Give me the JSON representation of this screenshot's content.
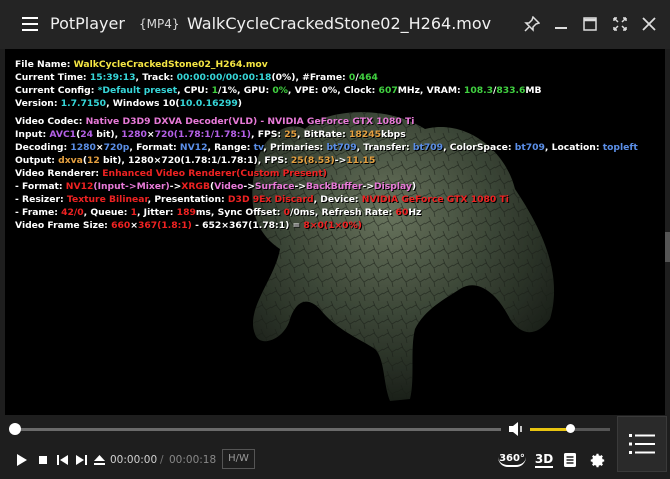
{
  "titlebar": {
    "app_name": "PotPlayer",
    "format_tag": "{MP4}",
    "file_title": "WalkCycleCrackedStone02_H264.mov"
  },
  "osd": {
    "file_name": {
      "label": "File Name: ",
      "value": "WalkCycleCrackedStone02_H264.mov"
    },
    "current_time": {
      "label": "Current Time: ",
      "time": "15:39:13",
      "track_label": ", Track: ",
      "track_pos": "00:00:00",
      "track_dur": "00:00:18",
      "pct": "(0%)",
      "frame_label": ", #Frame: ",
      "frame_cur": "0",
      "frame_total": "464"
    },
    "current_config": {
      "label": "Current Config: ",
      "preset": "*Default preset",
      "cpu_label": ", CPU: ",
      "cpu_val": "1",
      "cpu_pct": "1%",
      "gpu_label": ", GPU: ",
      "gpu_val": "0%",
      "vpe_label": ", VPE: ",
      "vpe_val": "0%",
      "clock_label": ", Clock: ",
      "clock_val": "607",
      "clock_unit": "MHz, VRAM: ",
      "vram_used": "108.3",
      "vram_total": "833.6",
      "vram_unit": "MB"
    },
    "version": {
      "label": "Version: ",
      "value": "1.7.7150",
      "os_label": ", Windows 10(",
      "os_build": "10.0.16299",
      "close": ")"
    },
    "video_codec": {
      "label": "Video Codec: ",
      "value": "Native D3D9 DXVA Decoder(VLD) - NVIDIA GeForce GTX 1080 Ti"
    },
    "input": {
      "label": "Input: ",
      "codec": "AVC1",
      "bits": "24",
      "bits_unit": " bit), ",
      "width": "1280",
      "height": "720",
      "aspect": "(1.78:1/1.78:1)",
      "fps_label": ", FPS: ",
      "fps": "25",
      "br_label": ", BitRate: ",
      "bitrate": "18245",
      "br_unit": "kbps"
    },
    "decoding": {
      "label": "Decoding: ",
      "width": "1280",
      "height": "720p",
      "format_label": ", Format: ",
      "format": "NV12",
      "range_label": ", Range: ",
      "range": "tv",
      "prim_label": ", Primaries: ",
      "primaries": "bt709",
      "transfer_label": ", Transfer: ",
      "transfer": "bt709",
      "cs_label": ", ColorSpace: ",
      "colorspace": "bt709",
      "loc_label": ", Location: ",
      "location": "topleft"
    },
    "output": {
      "label": "Output: ",
      "format": "dxva",
      "bits": "12",
      "res_text": " bit), 1280×720(1.78:1/1.78:1), FPS: ",
      "fps": "25",
      "fps_actual": "(8.53)",
      "arrow": "->",
      "fps_out": "11.15"
    },
    "renderer": {
      "label": "Video Renderer: ",
      "value": "Enhanced Video Renderer(Custom Present)"
    },
    "r_format": {
      "label": " - Format: ",
      "in_fmt": "NV12",
      "in_note": "(Input->Mixer)",
      "arrow": "->",
      "out_fmt": "XRGB",
      "paren_open": "(",
      "v1": "Video",
      "v2": "Surface",
      "v3": "BackBuffer",
      "v4": "Display",
      "paren_close": ")"
    },
    "r_resizer": {
      "label": " - Resizer: ",
      "resizer": "Texture Bilinear",
      "pres_label": ", Presentation: ",
      "presentation": "D3D 9Ex Discard",
      "dev_label": ", Device: ",
      "device": "NVIDIA GeForce GTX 1080 Ti"
    },
    "r_frame": {
      "label": " - Frame: ",
      "frame": "42/0",
      "queue_label": ", Queue: ",
      "queue": "1",
      "jitter_label": ", Jitter: ",
      "jitter": "189",
      "jitter_unit": "ms, Sync Offset: ",
      "sync": "0",
      "sync_unit": "/0ms, Refresh Rate: ",
      "refresh": "60",
      "refresh_unit": "Hz"
    },
    "frame_size": {
      "label": "Video Frame Size: ",
      "src_w": "660",
      "src_h": "367",
      "src_ratio": "(1.8:1)",
      "minus": " - ",
      "dst": "652×367(1.78:1)",
      "eq": " = ",
      "diff": "8×0(1×0%)"
    }
  },
  "playback": {
    "position": 0.0,
    "volume": 0.5,
    "time_current": "00:00:00",
    "time_sep": "/",
    "time_total": "00:00:18",
    "hw_label": "H/W",
    "btn_360": "360°",
    "btn_3d": "3D"
  },
  "colors": {
    "yellow": "#f5e643",
    "cyan": "#36d6d8",
    "green": "#40d040",
    "pink": "#e87ad8",
    "red": "#ee2222",
    "blue": "#5b8fe8",
    "purple": "#b460e6",
    "volume": "#e8c410"
  }
}
